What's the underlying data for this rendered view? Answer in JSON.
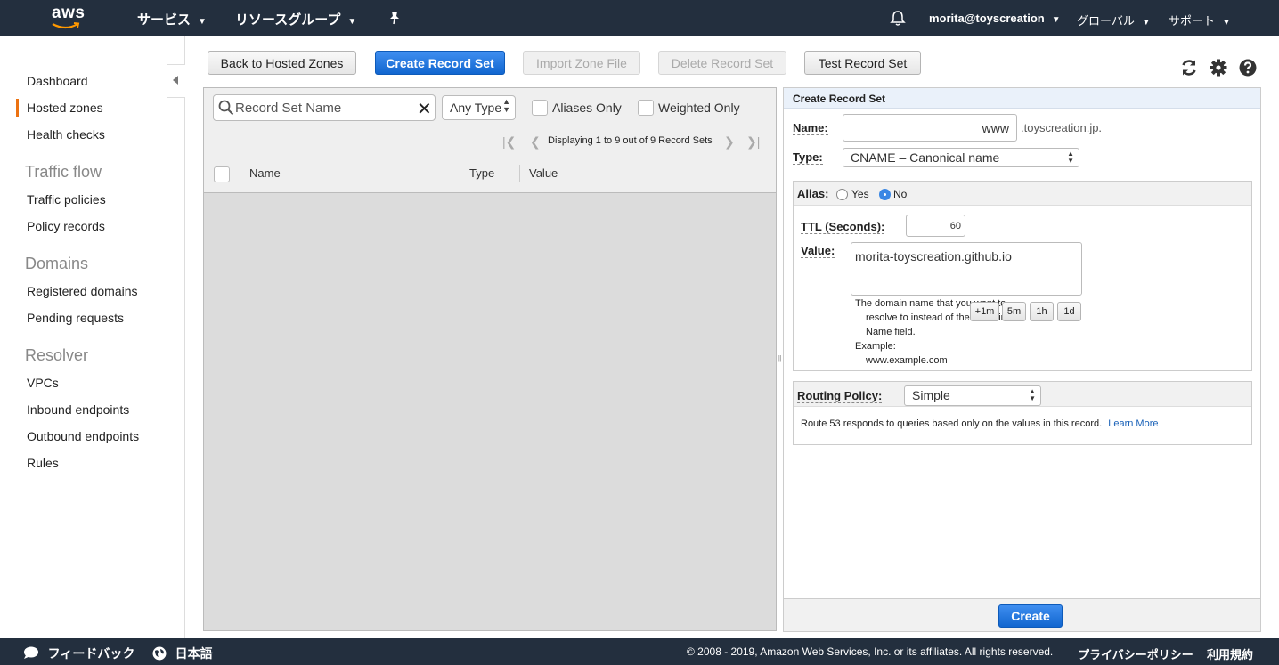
{
  "topnav": {
    "logo": "aws",
    "services": "サービス",
    "resource_groups": "リソースグループ",
    "account": "morita@toyscreation",
    "region": "グローバル",
    "support": "サポート"
  },
  "sidebar": {
    "items": [
      {
        "label": "Dashboard"
      },
      {
        "label": "Hosted zones"
      },
      {
        "label": "Health checks"
      },
      {
        "label": "Traffic policies"
      },
      {
        "label": "Policy records"
      },
      {
        "label": "Registered domains"
      },
      {
        "label": "Pending requests"
      },
      {
        "label": "VPCs"
      },
      {
        "label": "Inbound endpoints"
      },
      {
        "label": "Outbound endpoints"
      },
      {
        "label": "Rules"
      }
    ],
    "sections": [
      "Traffic flow",
      "Domains",
      "Resolver"
    ],
    "active": "Hosted zones"
  },
  "toolbar": {
    "back": "Back to Hosted Zones",
    "create": "Create Record Set",
    "import": "Import Zone File",
    "delete": "Delete Record Set",
    "test": "Test Record Set"
  },
  "list": {
    "search_placeholder": "Record Set Name",
    "type_filter": "Any Type",
    "aliases_only": "Aliases Only",
    "weighted_only": "Weighted Only",
    "pager_text": "Displaying 1 to 9 out of 9 Record Sets",
    "columns": [
      "Name",
      "Type",
      "Value"
    ]
  },
  "form": {
    "header": "Create Record Set",
    "name_label": "Name:",
    "name_value": "www",
    "domain_suffix": ".toyscreation.jp.",
    "type_label": "Type:",
    "type_value": "CNAME – Canonical name",
    "alias_label": "Alias:",
    "alias_yes": "Yes",
    "alias_no": "No",
    "alias_selected": "No",
    "ttl_label": "TTL (Seconds):",
    "ttl_value": "60",
    "ttl_buttons": [
      "+1m",
      "5m",
      "1h",
      "1d"
    ],
    "value_label": "Value:",
    "value_text": "morita-toyscreation.github.io",
    "help_lines": [
      "The domain name that you want to",
      "resolve to instead of the value in the",
      "Name field.",
      "Example:",
      "www.example.com"
    ],
    "routing_label": "Routing Policy:",
    "routing_value": "Simple",
    "routing_help": "Route 53 responds to queries based only on the values in this record.",
    "learn_more": "Learn More",
    "create_button": "Create"
  },
  "footer": {
    "feedback": "フィードバック",
    "language": "日本語",
    "copyright": "© 2008 - 2019, Amazon Web Services, Inc. or its affiliates. All rights reserved.",
    "privacy": "プライバシーポリシー",
    "terms": "利用規約"
  },
  "colors": {
    "nav_bg": "#232f3e",
    "primary_btn": "#1166cf",
    "active_indicator": "#ec7211",
    "link": "#1a62b8"
  }
}
